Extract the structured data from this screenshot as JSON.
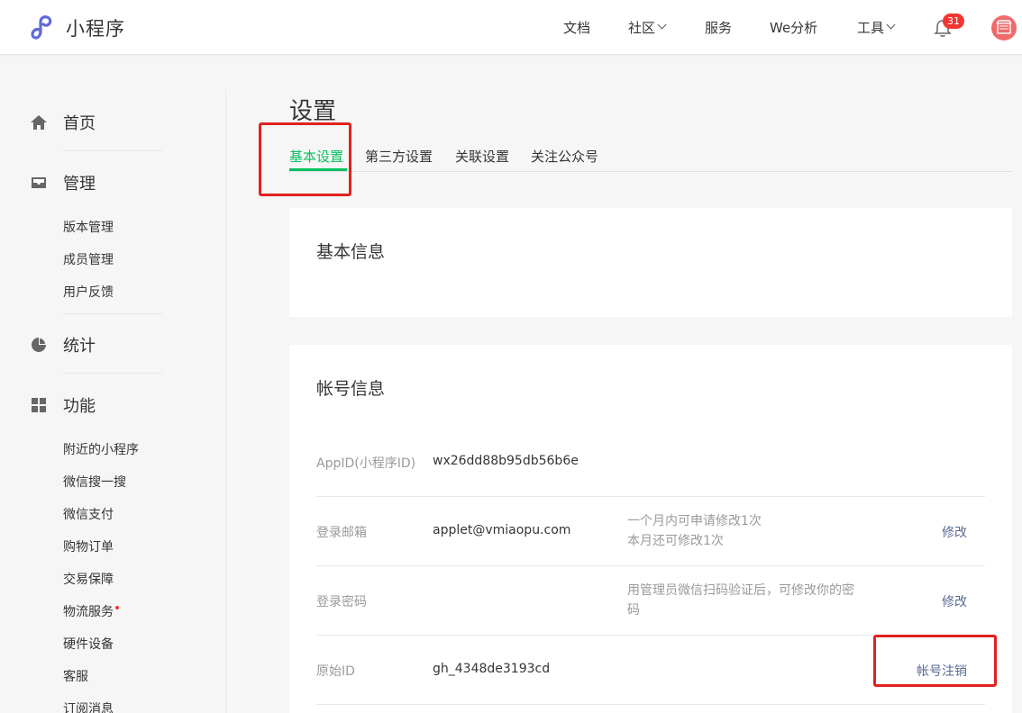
{
  "header": {
    "logo_text": "小程序",
    "nav": [
      {
        "label": "文档"
      },
      {
        "label": "社区"
      },
      {
        "label": "服务"
      },
      {
        "label": "We分析"
      },
      {
        "label": "工具"
      }
    ],
    "notification_count": "31",
    "accent_color": "#07c160"
  },
  "sidebar": {
    "home": "首页",
    "manage": "管理",
    "manage_items": [
      "版本管理",
      "成员管理",
      "用户反馈"
    ],
    "stats": "统计",
    "features": "功能",
    "feature_items": [
      "附近的小程序",
      "微信搜一搜",
      "微信支付",
      "购物订单",
      "交易保障",
      "物流服务",
      "硬件设备",
      "客服",
      "订阅消息"
    ]
  },
  "main": {
    "title": "设置",
    "tabs": [
      "基本设置",
      "第三方设置",
      "关联设置",
      "关注公众号"
    ],
    "basic_info_title": "基本信息",
    "account_info_title": "帐号信息",
    "rows": [
      {
        "label": "AppID(小程序ID)",
        "value": "wx26dd88b95db56b6e"
      },
      {
        "label": "登录邮箱",
        "value": "applet@vmiaopu.com",
        "desc1": "一个月内可申请修改1次",
        "desc2": "本月还可修改1次",
        "action": "修改"
      },
      {
        "label": "登录密码",
        "desc1": "用管理员微信扫码验证后，可修改你的密",
        "desc2": "码",
        "action": "修改"
      },
      {
        "label": "原始ID",
        "value": "gh_4348de3193cd",
        "action": "帐号注销"
      }
    ]
  }
}
